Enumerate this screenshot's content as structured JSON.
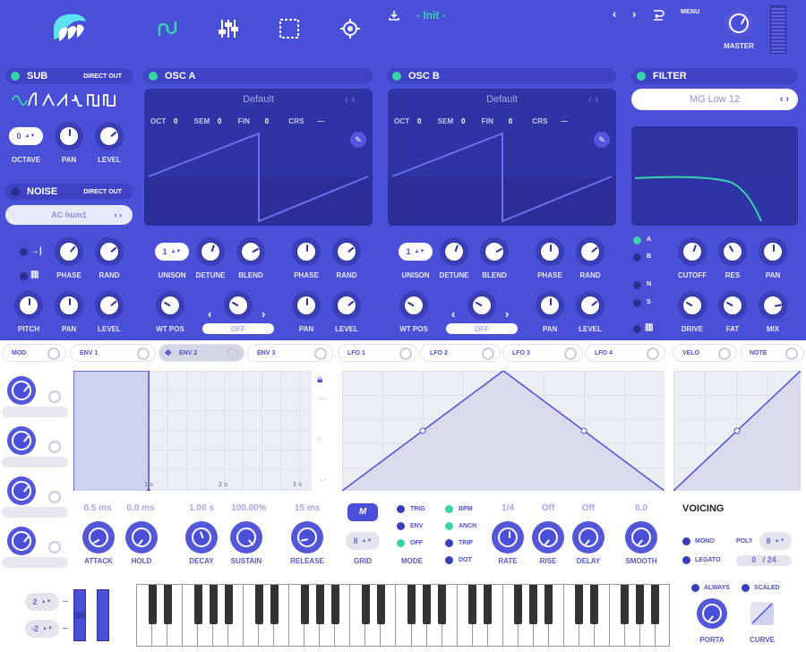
{
  "header": {
    "preset": "- Init -",
    "menu": "MENU",
    "master": "MASTER"
  },
  "sub": {
    "title": "SUB",
    "direct": "DIRECT OUT",
    "octave_val": "0",
    "octave": "OCTAVE",
    "pan": "PAN",
    "level": "LEVEL"
  },
  "noise": {
    "title": "NOISE",
    "direct": "DIRECT OUT",
    "preset": "AC hum1",
    "phase": "PHASE",
    "rand": "RAND",
    "pitch": "PITCH",
    "pan": "PAN",
    "level": "LEVEL"
  },
  "osca": {
    "title": "OSC A",
    "preset": "Default",
    "oct": "OCT",
    "oct_v": "0",
    "sem": "SEM",
    "sem_v": "0",
    "fin": "FIN",
    "fin_v": "0",
    "crs": "CRS",
    "crs_v": "—",
    "unison_v": "1",
    "unison": "UNISON",
    "detune": "DETUNE",
    "blend": "BLEND",
    "phase": "PHASE",
    "rand": "RAND",
    "wtpos": "WT POS",
    "off": "OFF",
    "pan": "PAN",
    "level": "LEVEL"
  },
  "oscb": {
    "title": "OSC B",
    "preset": "Default",
    "oct": "OCT",
    "oct_v": "0",
    "sem": "SEM",
    "sem_v": "0",
    "fin": "FIN",
    "fin_v": "0",
    "crs": "CRS",
    "crs_v": "—",
    "unison_v": "1",
    "unison": "UNISON",
    "detune": "DETUNE",
    "blend": "BLEND",
    "phase": "PHASE",
    "rand": "RAND",
    "wtpos": "WT POS",
    "off": "OFF",
    "pan": "PAN",
    "level": "LEVEL"
  },
  "filter": {
    "title": "FILTER",
    "preset": "MG Low 12",
    "a": "A",
    "b": "B",
    "n": "N",
    "s": "S",
    "cutoff": "CUTOFF",
    "res": "RES",
    "pan": "PAN",
    "drive": "DRIVE",
    "fat": "FAT",
    "mix": "MIX"
  },
  "tabs": {
    "mod": "MOD",
    "env1": "ENV 1",
    "env2": "ENV 2",
    "env3": "ENV 3",
    "lfo1": "LFO 1",
    "lfo2": "LFO 2",
    "lfo3": "LFO 3",
    "lfo4": "LFO 4",
    "velo": "VELO",
    "note": "NOTE"
  },
  "env": {
    "attack_v": "0.5 ms",
    "hold_v": "0.0 ms",
    "decay_v": "1.00 s",
    "sustain_v": "100.00%",
    "release_v": "15 ms",
    "attack": "ATTACK",
    "hold": "HOLD",
    "decay": "DECAY",
    "sustain": "SUSTAIN",
    "release": "RELEASE",
    "m1": "1 s",
    "m2": "2 s",
    "m3": "3 s"
  },
  "lfo": {
    "grid_v": "8",
    "grid": "GRID",
    "trig": "TRIG",
    "env": "ENV",
    "off": "OFF",
    "mode": "MODE",
    "bpm": "BPM",
    "anch": "ANCH",
    "trip": "TRIP",
    "dot": "DOT",
    "rate_v": "1/4",
    "rise_v": "Off",
    "delay_v": "Off",
    "smooth_v": "0.0",
    "rate": "RATE",
    "rise": "RISE",
    "delay": "DELAY",
    "smooth": "SMOOTH"
  },
  "voicing": {
    "title": "VOICING",
    "mono": "MONO",
    "poly": "POLY",
    "poly_v": "8",
    "legato": "LEGATO",
    "count": "0   / 24",
    "always": "ALWAYS",
    "scaled": "SCALED",
    "porta": "PORTA",
    "curve": "CURVE"
  },
  "kbd": {
    "up": "2",
    "down": "-2"
  }
}
